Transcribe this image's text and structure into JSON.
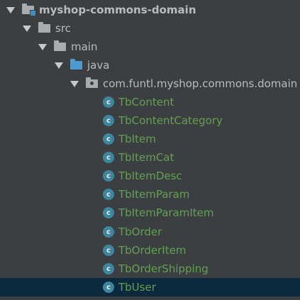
{
  "project_tree": {
    "module": {
      "name": "myshop-commons-domain"
    },
    "src": {
      "name": "src"
    },
    "main": {
      "name": "main"
    },
    "java": {
      "name": "java"
    },
    "package": {
      "name": "com.funtl.myshop.commons.domain"
    },
    "classes": [
      {
        "name": "TbContent",
        "icon": "class-icon",
        "icon_letter": "c"
      },
      {
        "name": "TbContentCategory",
        "icon": "class-icon",
        "icon_letter": "c"
      },
      {
        "name": "TbItem",
        "icon": "class-icon",
        "icon_letter": "c"
      },
      {
        "name": "TbItemCat",
        "icon": "class-icon",
        "icon_letter": "c"
      },
      {
        "name": "TbItemDesc",
        "icon": "class-icon",
        "icon_letter": "c"
      },
      {
        "name": "TbItemParam",
        "icon": "class-icon",
        "icon_letter": "c"
      },
      {
        "name": "TbItemParamItem",
        "icon": "class-icon",
        "icon_letter": "c"
      },
      {
        "name": "TbOrder",
        "icon": "class-icon",
        "icon_letter": "c"
      },
      {
        "name": "TbOrderItem",
        "icon": "class-icon",
        "icon_letter": "c"
      },
      {
        "name": "TbOrderShipping",
        "icon": "class-icon",
        "icon_letter": "c"
      },
      {
        "name": "TbUser",
        "icon": "class-icon",
        "icon_letter": "c",
        "selected": true
      }
    ]
  },
  "colors": {
    "background": "#3c3f41",
    "selection": "#0d293e",
    "text": "#bbbbbb",
    "class_text": "#62a150",
    "class_icon": "#3e86a0",
    "folder": "#a8acae",
    "source_folder": "#4a9bcf"
  }
}
